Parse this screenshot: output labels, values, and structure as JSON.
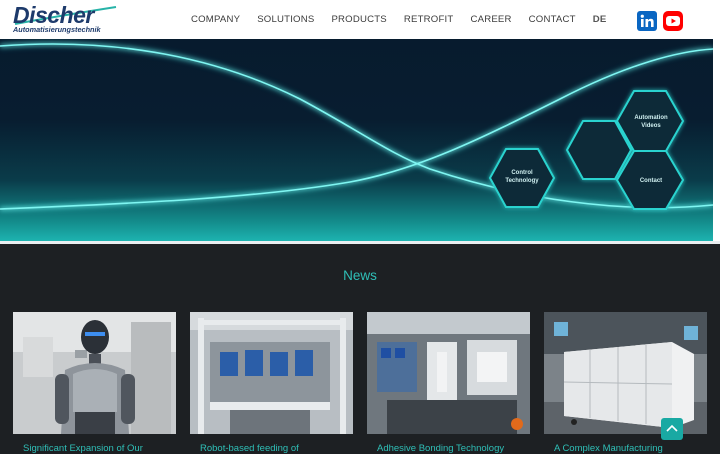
{
  "header": {
    "logo_main": "Discher",
    "logo_sub": "Automatisierungstechnik",
    "nav": [
      "COMPANY",
      "SOLUTIONS",
      "PRODUCTS",
      "RETROFIT",
      "CAREER",
      "CONTACT"
    ],
    "lang": "DE",
    "social": [
      "linkedin-icon",
      "youtube-icon"
    ]
  },
  "hero": {
    "hexagons": {
      "control": "Control Technology",
      "videos": "Automation Videos",
      "contact": "Contact"
    }
  },
  "news": {
    "title": "News",
    "cards": [
      {
        "title": "Significant Expansion of Our"
      },
      {
        "title": "Robot-based feeding of"
      },
      {
        "title": "Adhesive Bonding Technology"
      },
      {
        "title": "A Complex Manufacturing"
      }
    ]
  },
  "colors": {
    "brand": "#1d3a6b",
    "accent": "#2fbfb7",
    "linkedin": "#0a66c2",
    "youtube": "#ff0000"
  }
}
